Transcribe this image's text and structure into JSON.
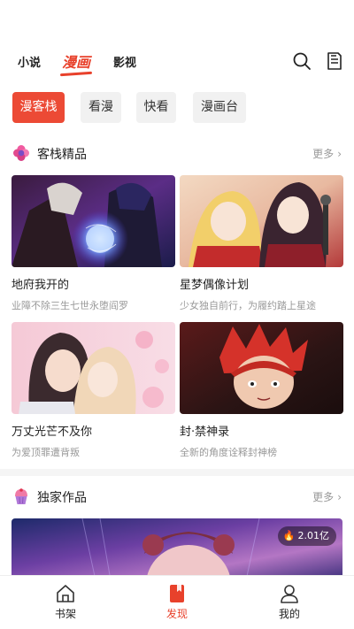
{
  "top_nav": {
    "tabs": [
      {
        "label": "小说"
      },
      {
        "label": "漫画"
      },
      {
        "label": "影视"
      }
    ],
    "active_tab": "漫画",
    "icons": [
      "search-icon",
      "history-icon"
    ]
  },
  "sources": {
    "chips": [
      {
        "label": "漫客栈"
      },
      {
        "label": "看漫"
      },
      {
        "label": "快看"
      },
      {
        "label": "漫画台"
      }
    ],
    "active": "漫客栈"
  },
  "sections": [
    {
      "title": "客栈精品",
      "more": "更多",
      "icon": "flower-icon",
      "items": [
        {
          "title": "地府我开的",
          "desc": "业障不除三生七世永堕阎罗"
        },
        {
          "title": "星梦偶像计划",
          "desc": "少女独自前行，为履约踏上星途"
        },
        {
          "title": "万丈光芒不及你",
          "desc": "为爱顶罪遭背叛"
        },
        {
          "title": "封·禁神录",
          "desc": "全新的角度诠释封神榜"
        }
      ]
    },
    {
      "title": "独家作品",
      "more": "更多",
      "icon": "cupcake-icon",
      "banner_heat": "2.01亿"
    }
  ],
  "bottom_bar": {
    "items": [
      {
        "label": "书架",
        "icon": "bookshelf-icon"
      },
      {
        "label": "发现",
        "icon": "discover-icon"
      },
      {
        "label": "我的",
        "icon": "profile-icon"
      }
    ],
    "active": "发现"
  },
  "colors": {
    "accent": "#e8412b",
    "chip_active": "#ec4a35",
    "chip_bg": "#f1f1f1",
    "muted_text": "#999999"
  }
}
